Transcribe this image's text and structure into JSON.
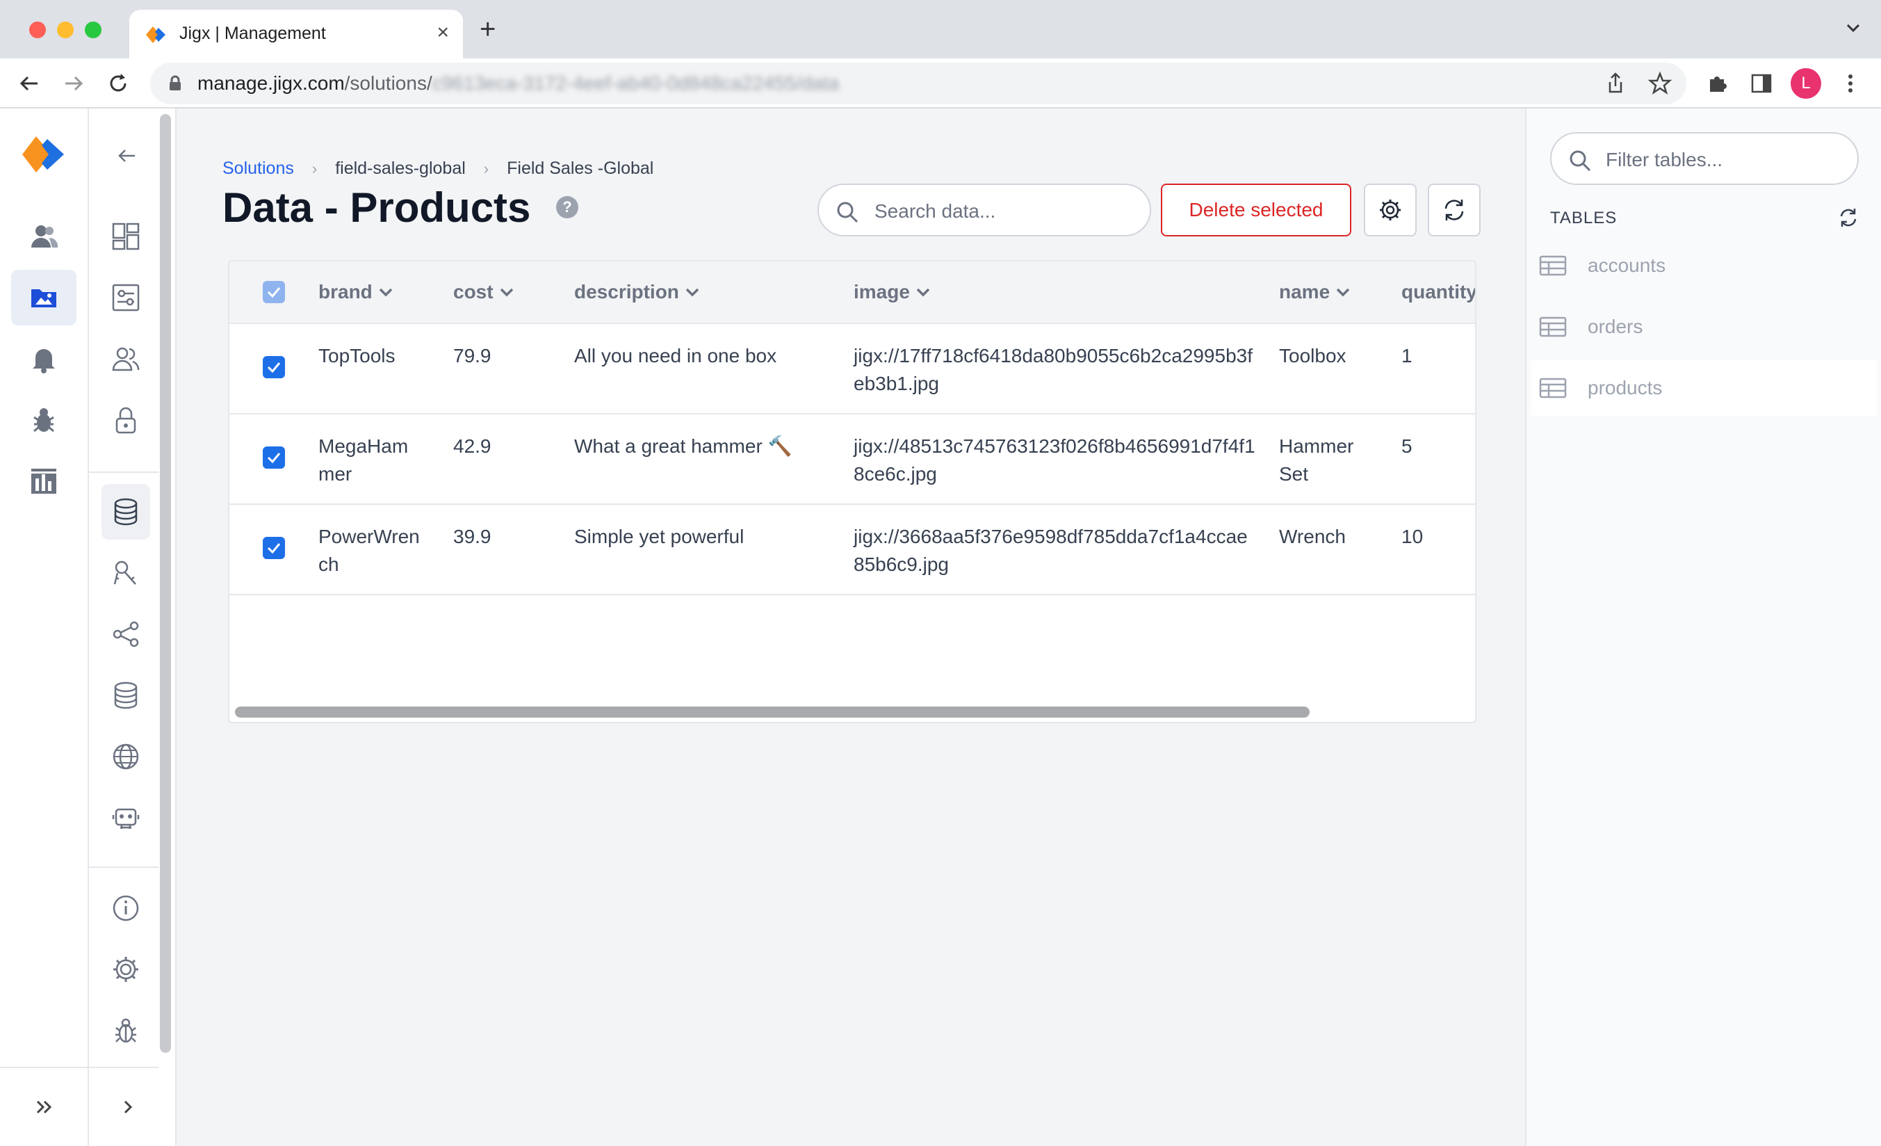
{
  "browser": {
    "tab_title": "Jigx | Management",
    "url_host": "manage.jigx.com",
    "url_path": "/solutions/",
    "url_blurred": "c9613eca-3172-4eef-ab40-0d848ca22455/data",
    "avatar_letter": "L"
  },
  "breadcrumb": {
    "items": [
      "Solutions",
      "field-sales-global",
      "Field Sales -Global"
    ]
  },
  "page": {
    "title": "Data - Products",
    "help": "?"
  },
  "search": {
    "placeholder": "Search data..."
  },
  "actions": {
    "delete_label": "Delete selected"
  },
  "table": {
    "columns": [
      "brand",
      "cost",
      "description",
      "image",
      "name",
      "quantity"
    ],
    "rows": [
      {
        "brand": "TopTools",
        "cost": "79.9",
        "description": "All you need in one box",
        "image": "jigx://17ff718cf6418da80b9055c6b2ca2995b3feb3b1.jpg",
        "name": "Toolbox",
        "quantity": "1"
      },
      {
        "brand": "MegaHammer",
        "cost": "42.9",
        "description": "What a great hammer 🔨",
        "image": "jigx://48513c745763123f026f8b4656991d7f4f18ce6c.jpg",
        "name": "Hammer Set",
        "quantity": "5"
      },
      {
        "brand": "PowerWrench",
        "cost": "39.9",
        "description": "Simple yet powerful",
        "image": "jigx://3668aa5f376e9598df785dda7cf1a4ccae85b6c9.jpg",
        "name": "Wrench",
        "quantity": "10"
      }
    ]
  },
  "tables_panel": {
    "filter_placeholder": "Filter tables...",
    "heading": "TABLES",
    "items": [
      "accounts",
      "orders",
      "products"
    ],
    "active": "products"
  },
  "colors": {
    "accent": "#2563eb",
    "danger": "#dc2626",
    "checkbox": "#1d6fe8",
    "logo_orange": "#f7931e",
    "logo_blue": "#1e6fe0"
  }
}
